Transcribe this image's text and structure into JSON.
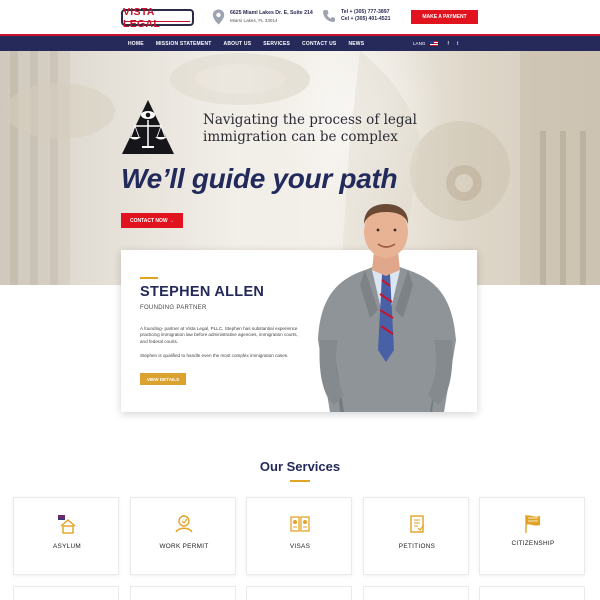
{
  "header": {
    "logo_text": "VISTA LEGAL",
    "address_line1": "6625 Miami Lakes Dr. E, Suite 214",
    "address_line2": "Miami Lakes, FL 33014",
    "phone_line1": "Tel + (305) 777-3897",
    "phone_line2": "Cel + (305) 401-4521",
    "payment_button": "MAKE A PAYMENT"
  },
  "nav": {
    "items": [
      {
        "label": "HOME"
      },
      {
        "label": "MISSION STATEMENT"
      },
      {
        "label": "ABOUT US"
      },
      {
        "label": "SERVICES"
      },
      {
        "label": "CONTACT US"
      },
      {
        "label": "NEWS"
      }
    ],
    "lang_label": "LANG",
    "social": [
      "f",
      "t"
    ]
  },
  "hero": {
    "tagline": "Navigating the process of legal immigration can be complex",
    "headline": "We’ll guide your path",
    "contact_button": "CONTACT NOW →"
  },
  "profile": {
    "name": "STEPHEN ALLEN",
    "role": "FOUNDING PARTNER",
    "paragraph1": "A founding- partner at Vista Legal, PLLC, Stephen has substantial experience practicing immigration law before administrative agencies, immigration courts, and federal courts.",
    "paragraph2": "Stephen is qualified to handle even the most complex immigration cases.",
    "button": "VIEW DETAILS"
  },
  "services": {
    "title": "Our Services",
    "items": [
      {
        "label": "ASYLUM",
        "icon": "house-flag-icon"
      },
      {
        "label": "WORK PERMIT",
        "icon": "work-permit-icon"
      },
      {
        "label": "VISAS",
        "icon": "visa-icon"
      },
      {
        "label": "PETITIONS",
        "icon": "document-icon"
      },
      {
        "label": "CITIZENSHIP",
        "icon": "flag-icon"
      }
    ]
  },
  "colors": {
    "navy": "#252a5b",
    "red": "#e1131f",
    "gold": "#dca22f"
  }
}
